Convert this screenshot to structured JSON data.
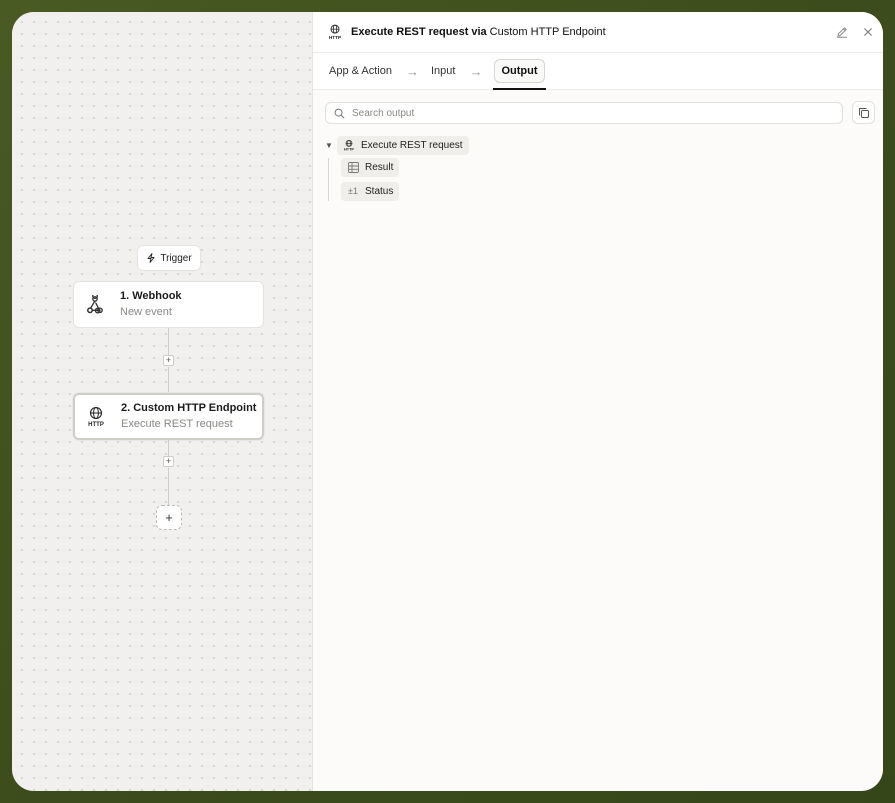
{
  "canvas": {
    "trigger_label": "Trigger",
    "nodes": [
      {
        "title": "1. Webhook",
        "subtitle": "New event",
        "icon": "webhook-icon"
      },
      {
        "title": "2. Custom HTTP Endpoint",
        "subtitle": "Execute REST request",
        "icon": "http-globe-icon"
      }
    ],
    "add_step_symbol": "+"
  },
  "panel": {
    "header": {
      "title": "Execute REST request",
      "via": "via",
      "app_name": "Custom HTTP Endpoint"
    },
    "tabs": [
      {
        "label": "App & Action",
        "active": false
      },
      {
        "label": "Input",
        "active": false
      },
      {
        "label": "Output",
        "active": true
      }
    ],
    "search": {
      "placeholder": "Search output",
      "value": ""
    },
    "tree": {
      "root_label": "Execute REST request",
      "children": [
        {
          "label": "Result",
          "icon": "table-icon"
        },
        {
          "label": "Status",
          "icon_text": "±1"
        }
      ]
    }
  },
  "colors": {
    "frame_green": "#3f4f1f",
    "canvas_bg": "#f1f0ee",
    "panel_bg": "#fcfbf9",
    "text_primary": "#111111",
    "text_muted": "#8b8985"
  }
}
